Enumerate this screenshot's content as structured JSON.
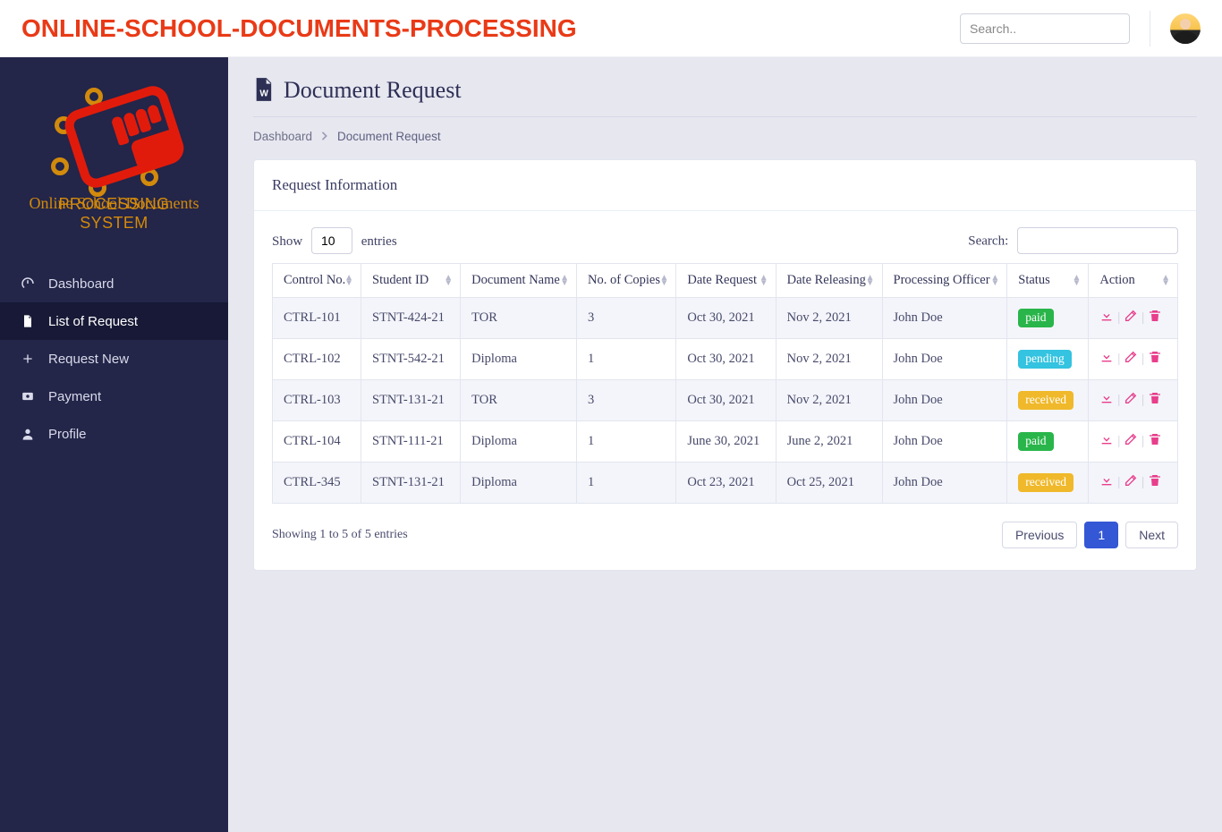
{
  "brand": "ONLINE-SCHOOL-DOCUMENTS-PROCESSING",
  "search_placeholder": "Search..",
  "logo": {
    "script": "Online School Documents",
    "block": "PROCESSING SYSTEM"
  },
  "sidebar": {
    "items": [
      {
        "label": "Dashboard"
      },
      {
        "label": "List of Request"
      },
      {
        "label": "Request New"
      },
      {
        "label": "Payment"
      },
      {
        "label": "Profile"
      }
    ]
  },
  "page": {
    "title": "Document Request"
  },
  "breadcrumb": {
    "root": "Dashboard",
    "current": "Document Request"
  },
  "card": {
    "title": "Request Information"
  },
  "datatable": {
    "show_label": "Show",
    "entries_label": "entries",
    "length_value": "10",
    "search_label": "Search:",
    "columns": [
      "Control No.",
      "Student ID",
      "Document Name",
      "No. of Copies",
      "Date Request",
      "Date Releasing",
      "Processing Officer",
      "Status",
      "Action"
    ],
    "rows": [
      {
        "control": "CTRL-101",
        "student": "STNT-424-21",
        "doc": "TOR",
        "copies": "3",
        "req": "Oct 30, 2021",
        "rel": "Nov 2, 2021",
        "officer": "John Doe",
        "status": "paid",
        "status_kind": "paid"
      },
      {
        "control": "CTRL-102",
        "student": "STNT-542-21",
        "doc": "Diploma",
        "copies": "1",
        "req": "Oct 30, 2021",
        "rel": "Nov 2, 2021",
        "officer": "John Doe",
        "status": "pending",
        "status_kind": "pending"
      },
      {
        "control": "CTRL-103",
        "student": "STNT-131-21",
        "doc": "TOR",
        "copies": "3",
        "req": "Oct 30, 2021",
        "rel": "Nov 2, 2021",
        "officer": "John Doe",
        "status": "received",
        "status_kind": "received"
      },
      {
        "control": "CTRL-104",
        "student": "STNT-111-21",
        "doc": "Diploma",
        "copies": "1",
        "req": "June 30, 2021",
        "rel": "June 2, 2021",
        "officer": "John Doe",
        "status": "paid",
        "status_kind": "paid"
      },
      {
        "control": "CTRL-345",
        "student": "STNT-131-21",
        "doc": "Diploma",
        "copies": "1",
        "req": "Oct 23, 2021",
        "rel": "Oct 25, 2021",
        "officer": "John Doe",
        "status": "received",
        "status_kind": "received"
      }
    ],
    "info": "Showing 1 to 5 of 5 entries",
    "prev": "Previous",
    "next": "Next",
    "page": "1"
  }
}
